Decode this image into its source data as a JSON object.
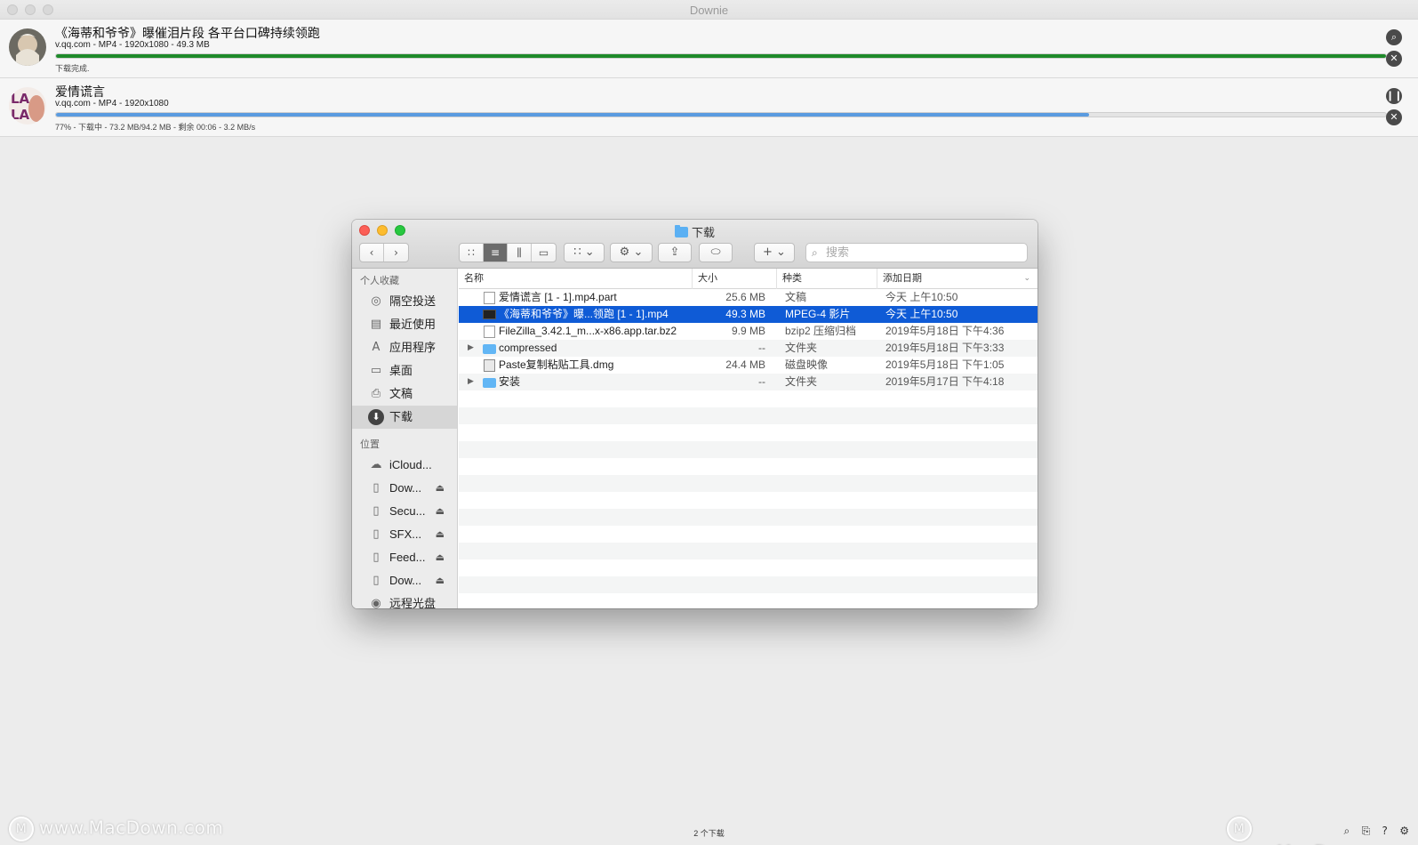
{
  "app": {
    "title": "Downie"
  },
  "downloads": [
    {
      "title": "《海蒂和爷爷》曝催泪片段 各平台口碑持续领跑",
      "meta": "v.qq.com - MP4 - 1920x1080 - 49.3 MB",
      "status": "下载完成.",
      "progress": 1.0,
      "bar_color": "#1e8a2a",
      "actions": [
        "search-icon",
        "close-icon"
      ]
    },
    {
      "title": "爱情谎言",
      "meta": "v.qq.com - MP4 - 1920x1080",
      "status": "77% - 下载中 - 73.2 MB/94.2 MB - 剩余 00:06 - 3.2 MB/s",
      "progress": 0.777,
      "bar_color": "#5a9be0",
      "actions": [
        "pause-icon",
        "close-icon"
      ]
    }
  ],
  "footer": {
    "count": "2 个下载"
  },
  "watermark": {
    "text": "www.MacDown.com"
  },
  "finder": {
    "title": "下载",
    "search_placeholder": "搜索",
    "sidebar": {
      "favorites_header": "个人收藏",
      "favorites": [
        {
          "label": "隔空投送",
          "icon": "airdrop-icon"
        },
        {
          "label": "最近使用",
          "icon": "recents-icon"
        },
        {
          "label": "应用程序",
          "icon": "applications-icon"
        },
        {
          "label": "桌面",
          "icon": "desktop-icon"
        },
        {
          "label": "文稿",
          "icon": "documents-icon"
        },
        {
          "label": "下载",
          "icon": "downloads-icon",
          "selected": true
        }
      ],
      "locations_header": "位置",
      "locations": [
        {
          "label": "iCloud...",
          "icon": "cloud-icon"
        },
        {
          "label": "Dow...",
          "icon": "disk-icon",
          "eject": true
        },
        {
          "label": "Secu...",
          "icon": "disk-icon",
          "eject": true
        },
        {
          "label": "SFX...",
          "icon": "disk-icon",
          "eject": true
        },
        {
          "label": "Feed...",
          "icon": "disk-icon",
          "eject": true
        },
        {
          "label": "Dow...",
          "icon": "disk-icon",
          "eject": true
        },
        {
          "label": "远程光盘",
          "icon": "remote-disc-icon"
        }
      ]
    },
    "columns": {
      "name": "名称",
      "size": "大小",
      "kind": "种类",
      "date": "添加日期"
    },
    "files": [
      {
        "name": "爱情谎言 [1 - 1].mp4.part",
        "size": "25.6 MB",
        "kind": "文稿",
        "date": "今天 上午10:50",
        "icon": "doc",
        "folder": false
      },
      {
        "name": "《海蒂和爷爷》曝...领跑 [1 - 1].mp4",
        "size": "49.3 MB",
        "kind": "MPEG-4 影片",
        "date": "今天 上午10:50",
        "icon": "video",
        "folder": false,
        "selected": true
      },
      {
        "name": "FileZilla_3.42.1_m...x-x86.app.tar.bz2",
        "size": "9.9 MB",
        "kind": "bzip2 压缩归档",
        "date": "2019年5月18日 下午4:36",
        "icon": "doc",
        "folder": false
      },
      {
        "name": "compressed",
        "size": "--",
        "kind": "文件夹",
        "date": "2019年5月18日 下午3:33",
        "icon": "folder",
        "folder": true
      },
      {
        "name": "Paste复制粘贴工具.dmg",
        "size": "24.4 MB",
        "kind": "磁盘映像",
        "date": "2019年5月18日 下午1:05",
        "icon": "dmg",
        "folder": false
      },
      {
        "name": "安装",
        "size": "--",
        "kind": "文件夹",
        "date": "2019年5月17日 下午4:18",
        "icon": "folder",
        "folder": true
      }
    ]
  }
}
